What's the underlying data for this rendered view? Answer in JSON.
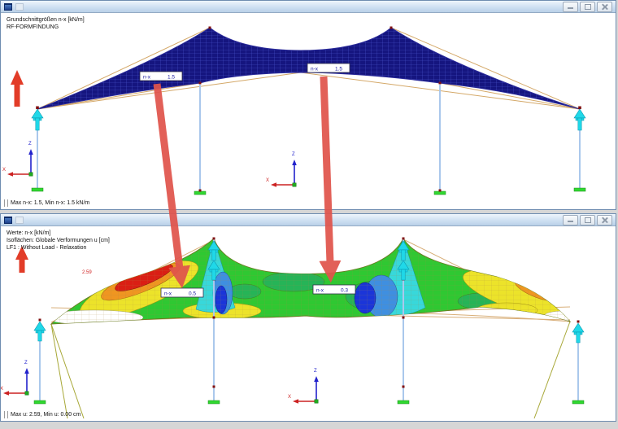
{
  "axes": {
    "x": "X",
    "z": "Z"
  },
  "top_window": {
    "info_line1": "Grundschnittgrößen n-x [kN/m]",
    "info_line2": "RF-FORMFINDUNG",
    "labels": {
      "left": {
        "name": "n-x",
        "value": "1.5"
      },
      "right": {
        "name": "n-x",
        "value": "1.5"
      }
    },
    "status": "Max n-x: 1.5, Min n-x: 1.5 kN/m"
  },
  "bottom_window": {
    "info_line1": "Werte: n-x [kN/m]",
    "info_line2": "Isoflächen: Globale Verformungen u [cm]",
    "info_line3": "LF1 : Without Load - Relaxation",
    "labels": {
      "left": {
        "name": "n-x",
        "value": "0.5"
      },
      "right": {
        "name": "n-x",
        "value": "0.3"
      }
    },
    "max_annotation": "2.59",
    "status": "Max u: 2.59, Min u: 0.00 cm"
  },
  "palette": {
    "titlebar_blue": "#cfe0f2",
    "membrane_navy": "#15157f",
    "membrane_grid_blue": "#4a54cc",
    "cable_tan": "#d4a868",
    "support_green": "#30d830",
    "node_dark_red": "#801010",
    "column_light_blue": "#aac8ec",
    "force_arrow_cyan": "#20d8e8",
    "annotation_arrow_red": "#e0544c",
    "axis_x_red": "#cc2222",
    "axis_z_blue": "#2222cc",
    "contour_scale": [
      "#da1f14",
      "#ef9621",
      "#ece32a",
      "#2fc832",
      "#26b45a",
      "#38d8da",
      "#3f8fe0",
      "#1b35d8",
      "#ffffff"
    ]
  }
}
